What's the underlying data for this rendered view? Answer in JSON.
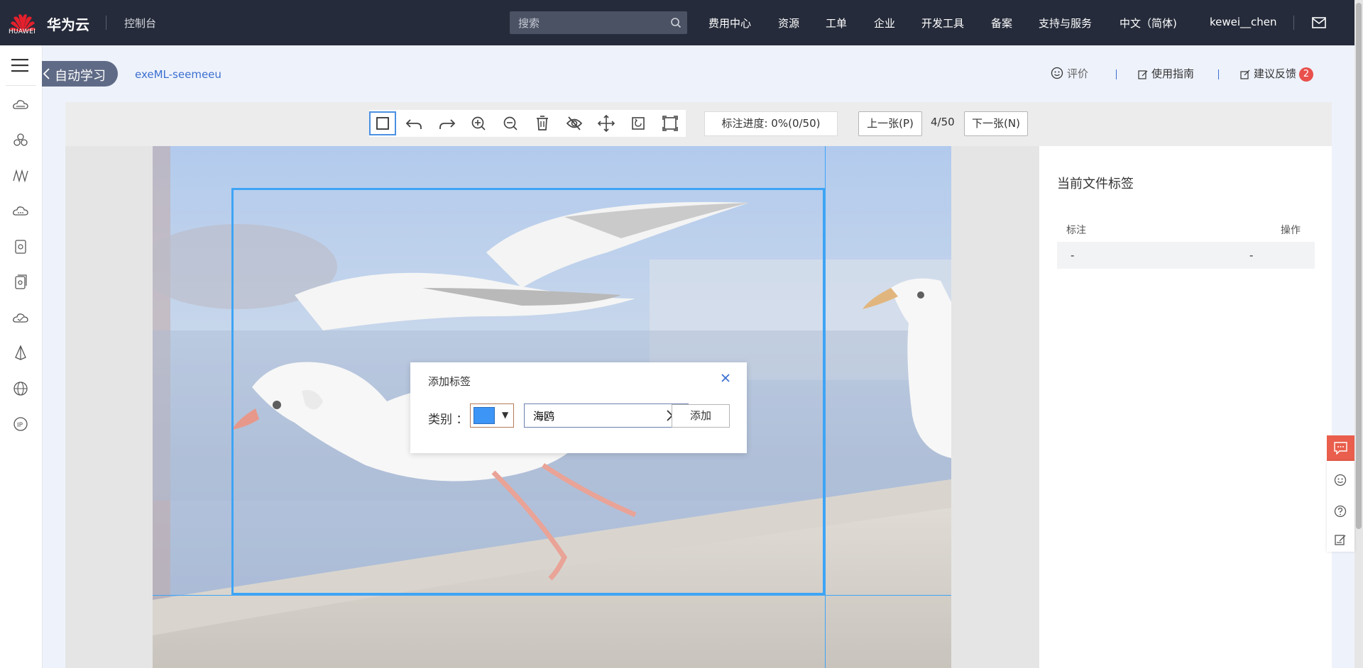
{
  "topbar": {
    "logo_text": "HUAWEI",
    "brand": "华为云",
    "console": "控制台",
    "search_placeholder": "搜索",
    "nav": [
      "费用中心",
      "资源",
      "工单",
      "企业",
      "开发工具",
      "备案",
      "支持与服务",
      "中文（简体)",
      "kewei__chen"
    ]
  },
  "subheader": {
    "back_label": "自动学习",
    "project_name": "exeML-seemeeu",
    "rate_label": "评价",
    "guide_label": "使用指南",
    "feedback_label": "建议反馈",
    "feedback_count": "2"
  },
  "toolbar": {
    "icons": [
      "rectangle-icon",
      "undo-icon",
      "redo-icon",
      "zoom-in-icon",
      "zoom-out-icon",
      "delete-icon",
      "hide-icon",
      "move-icon",
      "reset-icon",
      "fullscreen-icon"
    ],
    "progress": "标注进度: 0%(0/50)",
    "prev_label": "上一张(P)",
    "page": "4/50",
    "next_label": "下一张(N)"
  },
  "dialog": {
    "title": "添加标签",
    "category_label": "类别 ：",
    "swatch_color": "#3d95f5",
    "input_value": "海鸥",
    "add_label": "添加"
  },
  "right_panel": {
    "title": "当前文件标签",
    "col_label": "标注",
    "col_action": "操作",
    "row_label": "-",
    "row_action": "-"
  },
  "colors": {
    "topbar_bg": "#252b3a",
    "accent": "#3ea4f5",
    "feedback_badge": "#e9504c"
  }
}
